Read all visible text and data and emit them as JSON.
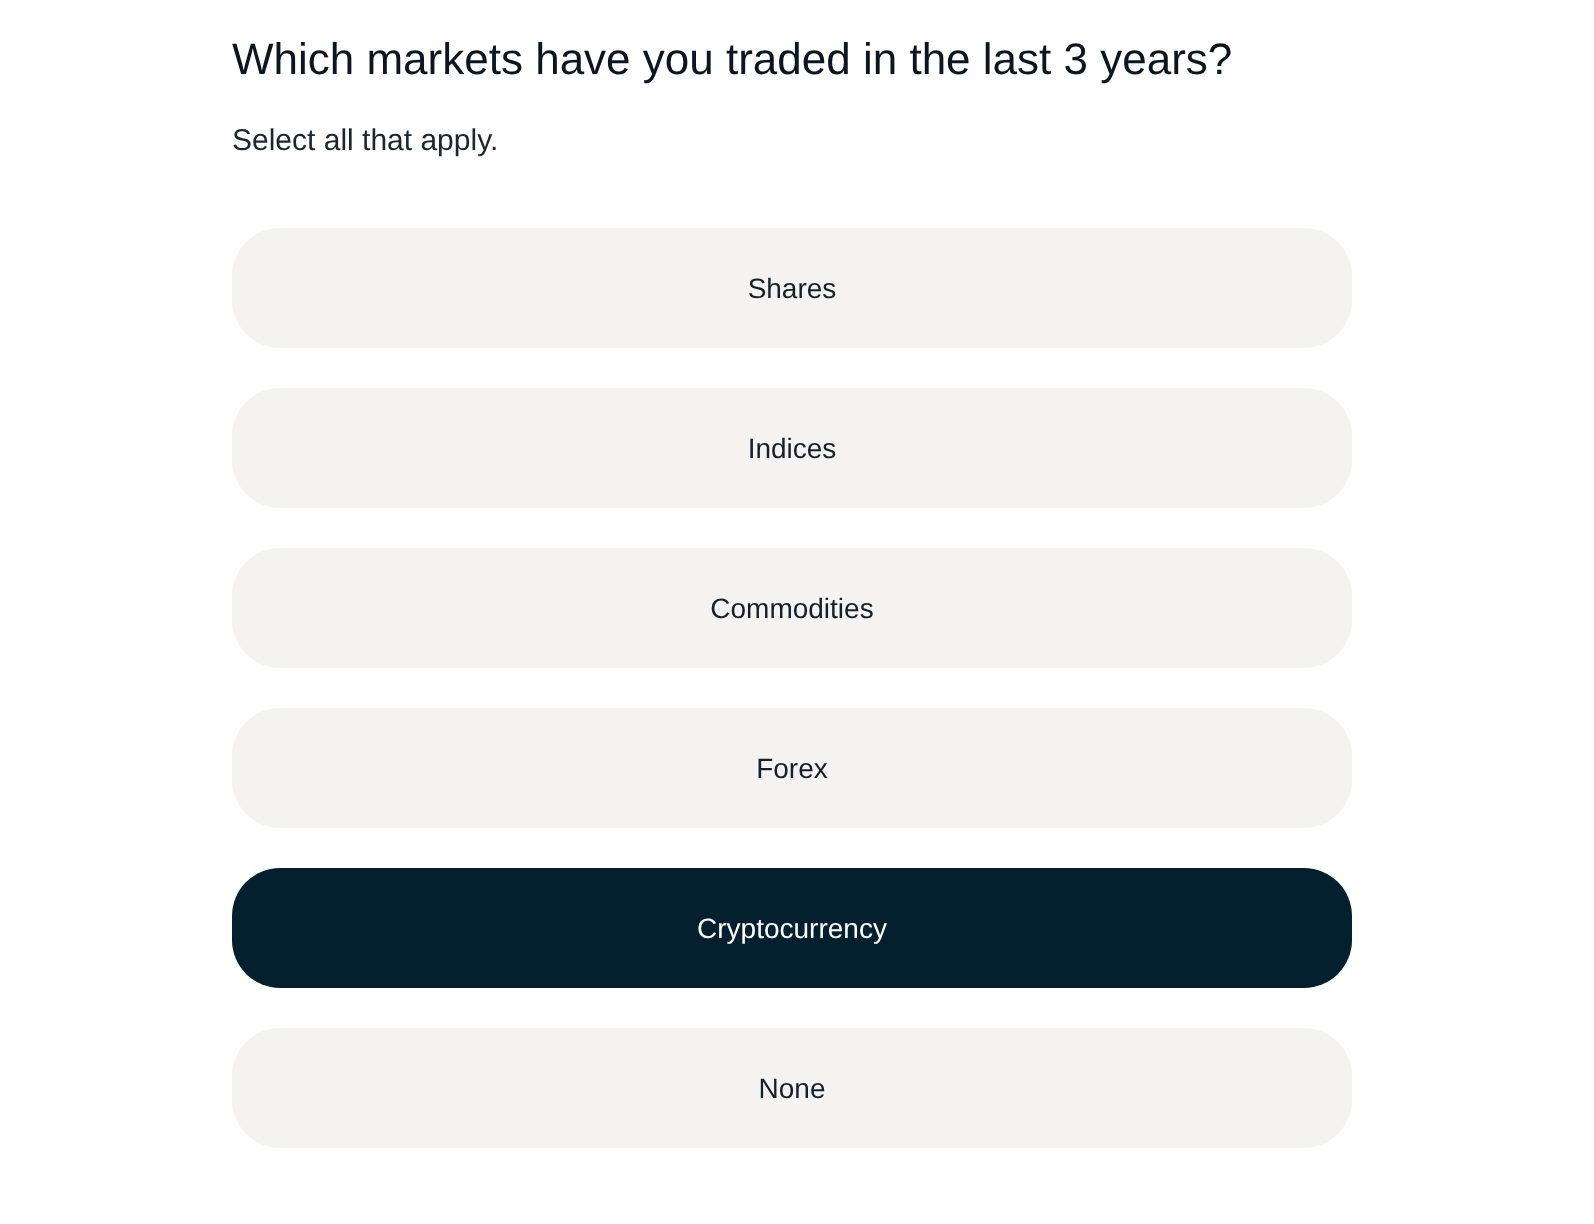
{
  "question": {
    "title": "Which markets have you traded in the last 3 years?",
    "hint": "Select all that apply."
  },
  "options": [
    {
      "label": "Shares",
      "selected": false
    },
    {
      "label": "Indices",
      "selected": false
    },
    {
      "label": "Commodities",
      "selected": false
    },
    {
      "label": "Forex",
      "selected": false
    },
    {
      "label": "Cryptocurrency",
      "selected": true
    },
    {
      "label": "None",
      "selected": false
    }
  ]
}
